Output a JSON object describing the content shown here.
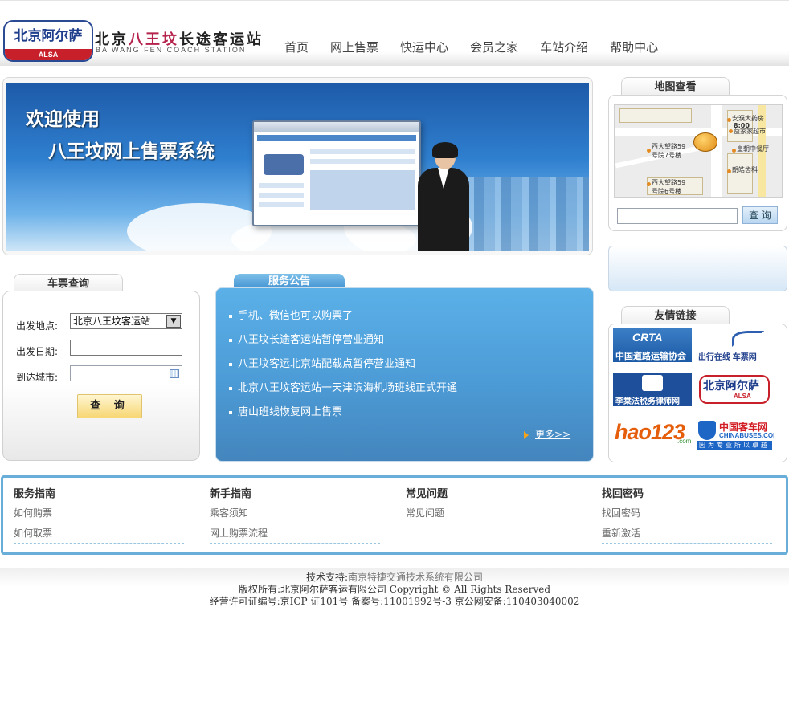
{
  "header": {
    "logo_text": "北京阿尔萨",
    "logo_sub": "ALSA",
    "station_name_prefix": "北京",
    "station_name_highlight": "八王坟",
    "station_name_suffix": "长途客运站",
    "station_name_en": "BA WANG FEN COACH STATION",
    "nav": [
      "首页",
      "网上售票",
      "快运中心",
      "会员之家",
      "车站介绍",
      "帮助中心"
    ]
  },
  "banner": {
    "line1": "欢迎使用",
    "line2": "八王坟网上售票系统"
  },
  "map": {
    "title": "地图查看",
    "labels": [
      "安濮大药房",
      "8:00",
      "益家家超市",
      "皇朝中餐厅",
      "西大望路59",
      "号院7号楼",
      "朗皓齿科",
      "西大望路59",
      "号院6号楼"
    ],
    "search_placeholder": "",
    "search_button": "查 询"
  },
  "query": {
    "title": "车票查询",
    "departure_label": "出发地点:",
    "departure_value": "北京八王坟客运站",
    "date_label": "出发日期:",
    "date_value": "",
    "city_label": "到达城市:",
    "city_value": "",
    "submit_label": "查 询"
  },
  "notice": {
    "title": "服务公告",
    "items": [
      "手机、微信也可以购票了",
      "八王坟长途客运站暂停营业通知",
      "八王坟客运北京站配载点暂停营业通知",
      "北京八王坟客运站一天津滨海机场班线正式开通",
      "唐山班线恢复网上售票"
    ],
    "more": "更多>>"
  },
  "links": {
    "title": "友情链接",
    "crta": {
      "big": "CRTA",
      "small": "中国道路运输协会"
    },
    "cxzx": {
      "small": "出行在线 车票网"
    },
    "law": {
      "small": "李棠法税务律师网"
    },
    "alsa": {
      "big": "北京阿尔萨",
      "small": "ALSA"
    },
    "hao": {
      "big": "hao123",
      "small": ".com"
    },
    "bus": {
      "big": "中国客车网",
      "mid": "CHINABUSES.COM",
      "small": "因为专业所以卓越"
    }
  },
  "guide": {
    "columns": [
      {
        "title": "服务指南",
        "links": [
          "如何购票",
          "如何取票"
        ]
      },
      {
        "title": "新手指南",
        "links": [
          "乘客须知",
          "网上购票流程"
        ]
      },
      {
        "title": "常见问题",
        "links": [
          "常见问题",
          ""
        ]
      },
      {
        "title": "找回密码",
        "links": [
          "找回密码",
          "重新激活"
        ]
      }
    ]
  },
  "footer": {
    "tech_label": "技术支持:",
    "tech_value": "南京特捷交通技术系统有限公司",
    "copyright": "版权所有:北京阿尔萨客运有限公司  Copyright © All Rights Reserved",
    "license": "经营许可证编号:京ICP 证101号  备案号:11001992号-3 京公网安备:110403040002"
  },
  "colors": {
    "accent_blue": "#4c9bd6",
    "guide_border": "#68aed8",
    "brand_red": "#c8202a",
    "brand_navy": "#1f3e8c"
  }
}
